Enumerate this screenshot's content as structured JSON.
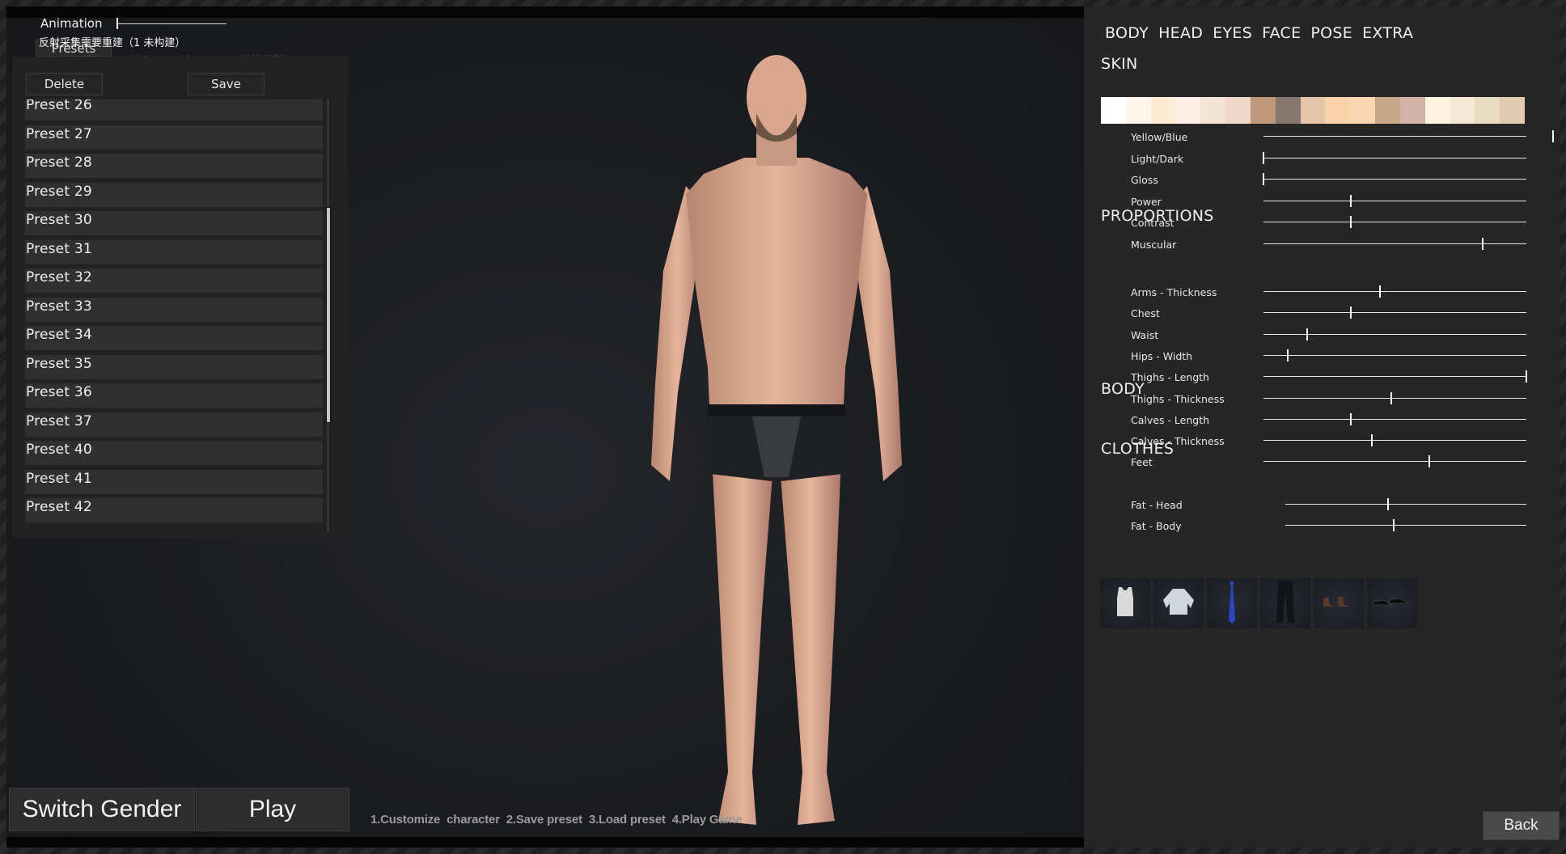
{
  "overlay": {
    "animation_label": "Animation",
    "animation_value": 0.0,
    "presets_tab_label": "Presets",
    "debug_message": "反射采集需要重建（1 未构建）",
    "debug_message_faded": "'DisableAllScreenMessages'进行抑制"
  },
  "presets_panel": {
    "delete_label": "Delete",
    "save_label": "Save",
    "items": [
      "Preset 26",
      "Preset 27",
      "Preset 28",
      "Preset 29",
      "Preset 30",
      "Preset 31",
      "Preset 32",
      "Preset 33",
      "Preset 34",
      "Preset 35",
      "Preset 36",
      "Preset 37",
      "Preset 40",
      "Preset 41",
      "Preset 42"
    ],
    "scroll_position": 0.5,
    "scroll_visible_fraction": 0.5
  },
  "bottom": {
    "switch_gender_label": "Switch Gender",
    "play_label": "Play",
    "instructions": "1.Customize  character  2.Save preset  3.Load preset  4.Play Game"
  },
  "side": {
    "tabs": [
      "BODY",
      "HEAD",
      "EYES",
      "FACE",
      "POSE",
      "EXTRA"
    ],
    "skin": {
      "title": "SKIN",
      "swatches": [
        "#ffffff",
        "#fff6eb",
        "#fdebd3",
        "#fdefe6",
        "#f3e4d6",
        "#f0d8c8",
        "#bd9a7d",
        "#87786d",
        "#e4c5ab",
        "#f8d2a8",
        "#f8d6b2",
        "#c8a88a",
        "#d2b4a6",
        "#fdf4e0",
        "#f5e8d4",
        "#e8dcc2",
        "#e2cbb0"
      ],
      "sliders": [
        {
          "label": "Yellow/Blue",
          "value": 1.1
        },
        {
          "label": "Light/Dark",
          "value": 0.0
        },
        {
          "label": "Gloss",
          "value": 0.0
        },
        {
          "label": "Power",
          "value": 0.333
        },
        {
          "label": "Contrast",
          "value": 0.333
        },
        {
          "label": "Muscular",
          "value": 0.833
        }
      ]
    },
    "proportions": {
      "title": "PROPORTIONS",
      "sliders": [
        {
          "label": "Arms - Thickness",
          "value": 0.444
        },
        {
          "label": "Chest",
          "value": 0.333
        },
        {
          "label": "Waist",
          "value": 0.166
        },
        {
          "label": "Hips - Width",
          "value": 0.092
        },
        {
          "label": "Thighs - Length",
          "value": 1.0
        },
        {
          "label": "Thighs - Thickness",
          "value": 0.486
        },
        {
          "label": "Calves - Length",
          "value": 0.333
        },
        {
          "label": "Calves - Thickness",
          "value": 0.412
        },
        {
          "label": "Feet",
          "value": 0.63
        }
      ]
    },
    "body": {
      "title": "BODY",
      "sliders": [
        {
          "label": "Fat - Head",
          "value": 0.426
        },
        {
          "label": "Fat - Body",
          "value": 0.449
        }
      ]
    },
    "clothes": {
      "title": "CLOTHES",
      "items": [
        "tank-top",
        "dress-shirt",
        "blue-tie",
        "black-pants",
        "brown-boots",
        "black-shoes"
      ]
    },
    "back_label": "Back"
  }
}
